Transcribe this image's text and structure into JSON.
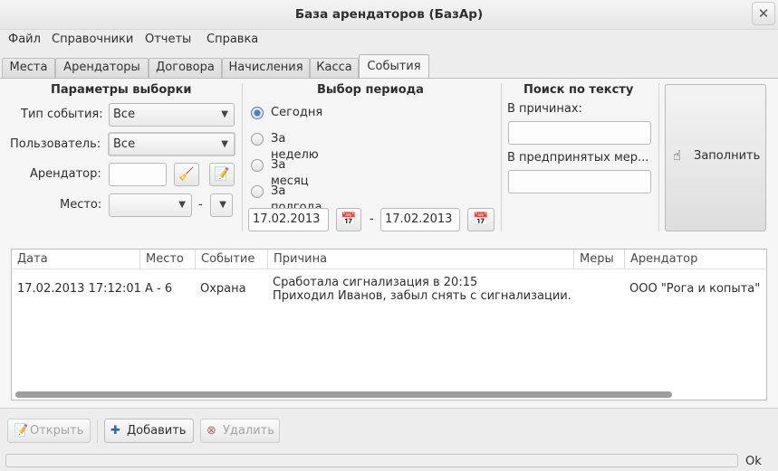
{
  "window": {
    "title": "База арендаторов (БазАр)"
  },
  "menu": [
    "Файл",
    "Справочники",
    "Отчеты",
    "Справка"
  ],
  "tabs": [
    "Места",
    "Арендаторы",
    "Договора",
    "Начисления",
    "Касса",
    "События"
  ],
  "params": {
    "title": "Параметры выборки",
    "event_type_label": "Тип события:",
    "event_type_value": "Все",
    "user_label": "Пользователь:",
    "user_value": "Все",
    "tenant_label": "Арендатор:",
    "tenant_value": "",
    "place_label": "Место:",
    "place_value": "",
    "place_dash": "-"
  },
  "period": {
    "title": "Выбор периода",
    "options": [
      "Сегодня",
      "За неделю",
      "За месяц",
      "За полгода"
    ],
    "selected": "Сегодня",
    "date_from": "17.02.2013",
    "date_to": "17.02.2013",
    "dash": "-"
  },
  "search": {
    "title": "Поиск по тексту",
    "reasons_label": "В причинах:",
    "reasons_value": "",
    "measures_label": "В предпринятых мер...",
    "measures_value": ""
  },
  "fill_button": {
    "label": "Заполнить",
    "icon": "hand-pointer-icon"
  },
  "table": {
    "columns": [
      "Дата",
      "Место",
      "Событие",
      "Причина",
      "Меры",
      "Арендатор"
    ],
    "rows": [
      {
        "date": "17.02.2013 17:12:01",
        "place": "А - 6",
        "event": "Охрана",
        "reason_line1": "Сработала сигнализация в 20:15",
        "reason_line2": "Приходил Иванов, забыл снять с сигнализации.",
        "measures": "",
        "tenant": "ООО \"Рога и копыта\""
      }
    ]
  },
  "toolbar": {
    "open_label": "Открыть",
    "add_label": "Добавить",
    "delete_label": "Удалить"
  },
  "status": {
    "ok_label": "Ok"
  }
}
